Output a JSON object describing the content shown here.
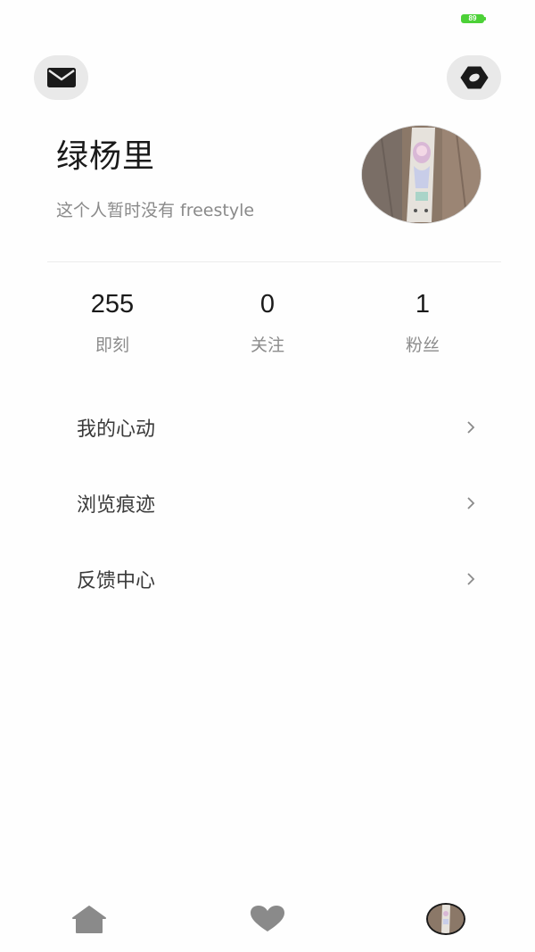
{
  "status_bar": {
    "battery_level": "89",
    "battery_color": "#4cd137"
  },
  "header": {
    "mail_icon": "envelope-icon",
    "settings_icon": "hexagon-settings-icon"
  },
  "profile": {
    "username": "绿杨里",
    "bio": "这个人暂时没有 freestyle",
    "avatar": "skateboard-photo-avatar"
  },
  "stats": [
    {
      "value": "255",
      "label": "即刻"
    },
    {
      "value": "0",
      "label": "关注"
    },
    {
      "value": "1",
      "label": "粉丝"
    }
  ],
  "menu": [
    {
      "label": "我的心动",
      "icon": "chevron-right-icon"
    },
    {
      "label": "浏览痕迹",
      "icon": "chevron-right-icon"
    },
    {
      "label": "反馈中心",
      "icon": "chevron-right-icon"
    }
  ],
  "bottom_nav": [
    {
      "icon": "home-icon"
    },
    {
      "icon": "heart-icon"
    },
    {
      "icon": "profile-avatar-icon"
    }
  ]
}
